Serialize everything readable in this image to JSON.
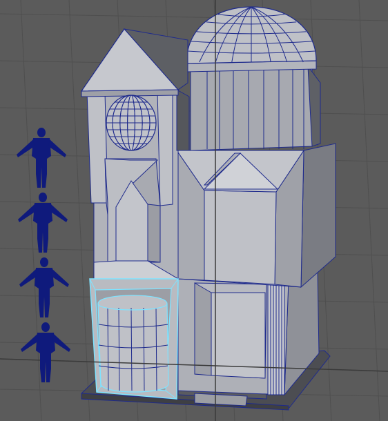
{
  "viewport": {
    "background": "#5b5b5b",
    "grid_color": "#4f4f4f",
    "axis_color": "#3a3a3a",
    "wire_color": "#1e2a8c",
    "selection_color": "#7fe3ff",
    "surface_light": "#bcbdc3",
    "surface_mid": "#a4a6ad",
    "surface_dark": "#6e7077",
    "surface_shadow": "#4c4d52",
    "scale_figure_color": "#0f1a7c",
    "scale_figure_count": 4,
    "selected_object": "cylinder-door"
  }
}
